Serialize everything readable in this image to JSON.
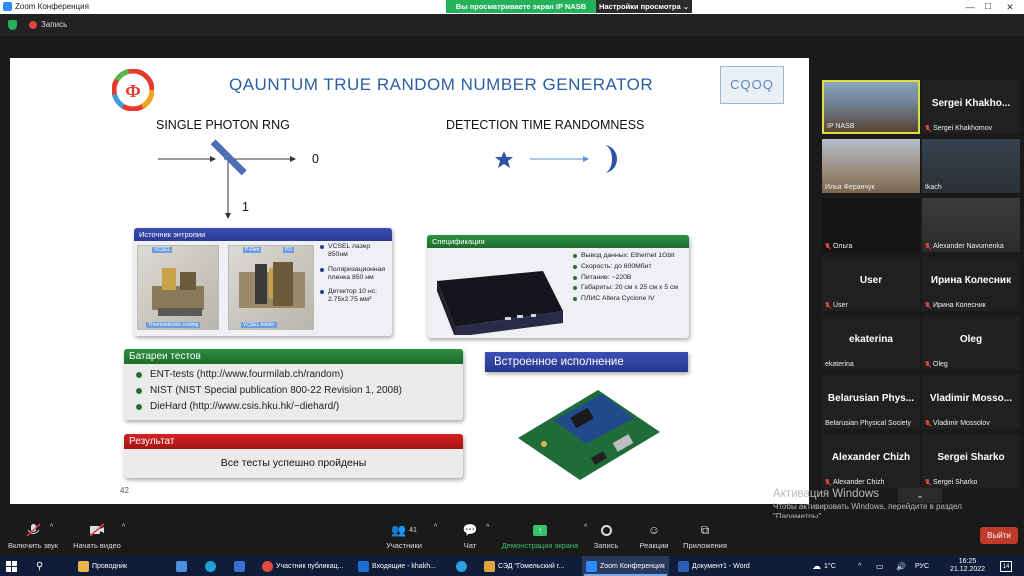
{
  "window": {
    "title": "Zoom Конференция",
    "min": "—",
    "max": "☐",
    "close": "✕"
  },
  "banner": {
    "viewing": "Вы просматриваете экран IP NASB",
    "settings": "Настройки просмотра ⌄"
  },
  "recording": {
    "label": "Запись"
  },
  "slide": {
    "title": "QAUNTUM TRUE RANDOM NUMBER  GENERATOR",
    "logo_right": "CQOQ",
    "left_heading": "SINGLE PHOTON  RNG",
    "right_heading": "DETECTION TIME RANDOMNESS",
    "out0": "0",
    "out1": "1",
    "entropy": {
      "header": "Источник энтропии",
      "tags": [
        "VCSEL",
        "P-Film",
        "PD",
        "Thermoelectric cooling",
        "VCSEL holder"
      ],
      "specs": [
        "VCSEL лазер 850нм",
        "Поляризационная пленка 850 нм",
        "Детектор 10 нс: 2.75x2.75 мм²"
      ]
    },
    "spec": {
      "header": "Спецификация",
      "items": [
        "Вывод данных: Ethernet 1Gbit",
        "Скорость: до 600Мбит",
        "Питание: ~220В",
        "Габариты: 20 см x 25 см x 5 см",
        "ПЛИС Altera Cyclone IV"
      ]
    },
    "tests": {
      "header": "Батареи тестов",
      "items": [
        "ENT-tests (http://www.fourmilab.ch/random)",
        "NIST (NIST Special publication 800-22 Revision 1, 2008)",
        "DieHard (http://www.csis.hku.hk/~diehard/)"
      ]
    },
    "result": {
      "header": "Результат",
      "text": "Все тесты успешно пройдены"
    },
    "builtin": "Встроенное исполнение",
    "page": "42"
  },
  "activation": {
    "line1": "Активация Windows",
    "line2": "Чтобы активировать Windows, перейдите в раздел \"Параметры\"."
  },
  "participants": [
    {
      "big": "",
      "name": "IP NASB",
      "muted": false
    },
    {
      "big": "Sergei  Khakho...",
      "name": "Sergei Khakhomov",
      "muted": true
    },
    {
      "big": "",
      "name": "Илья Феранчук",
      "muted": false
    },
    {
      "big": "",
      "name": "tkach",
      "muted": false
    },
    {
      "big": "",
      "name": "Ольга",
      "muted": true
    },
    {
      "big": "",
      "name": "Alexander Navumenka",
      "muted": true
    },
    {
      "big": "User",
      "name": "User",
      "muted": true
    },
    {
      "big": "Ирина Колесник",
      "name": "Ирина Колесник",
      "muted": true
    },
    {
      "big": "ekaterina",
      "name": "ekaterina",
      "muted": false
    },
    {
      "big": "Oleg",
      "name": "Oleg",
      "muted": true
    },
    {
      "big": "Belarusian  Phys...",
      "name": "Belarusian Physical Society",
      "muted": false
    },
    {
      "big": "Vladimir  Mosso...",
      "name": "Vladimir Mossolov",
      "muted": true
    },
    {
      "big": "Alexander Chizh",
      "name": "Alexander Chizh",
      "muted": true
    },
    {
      "big": "Sergei Sharko",
      "name": "Sergei Sharko",
      "muted": true
    }
  ],
  "toolbar": {
    "audio": "Включить звук",
    "video": "Начать видео",
    "participants": "Участники",
    "participants_count": "41",
    "chat": "Чат",
    "share": "Демонстрация экрана",
    "record": "Запись",
    "reactions": "Реакции",
    "apps": "Приложения",
    "exit": "Выйти"
  },
  "taskbar": {
    "items": [
      "Проводник",
      "Участник публикац...",
      "Входящие - khakh...",
      "СЭД \"Гомельский г...",
      "Zoom Конференция",
      "Документ1 - Word"
    ],
    "weather": "1°C",
    "lang": "РУС",
    "time": "16:25",
    "date": "21.12.2022",
    "badge": "14"
  }
}
